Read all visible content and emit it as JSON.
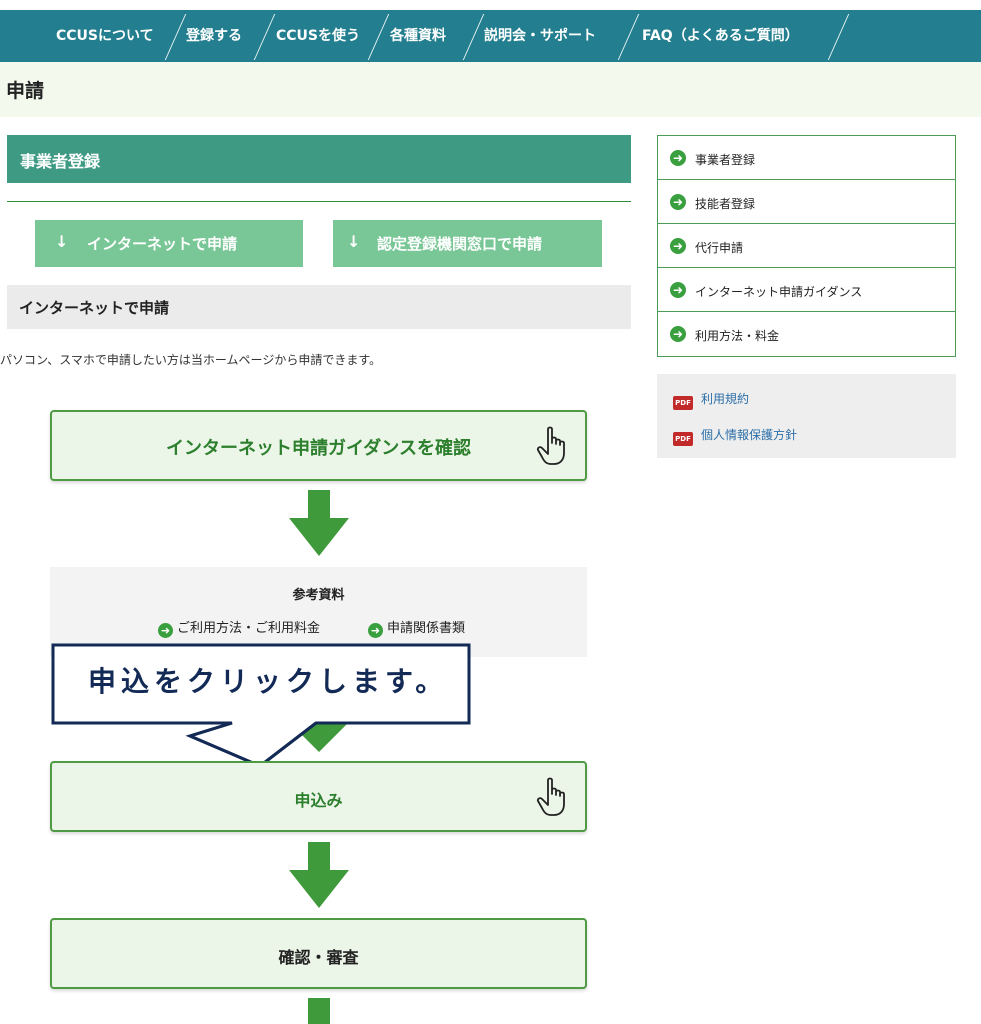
{
  "nav": {
    "items": [
      {
        "label": "CCUSについて"
      },
      {
        "label": "登録する"
      },
      {
        "label": "CCUSを使う"
      },
      {
        "label": "各種資料"
      },
      {
        "label": "説明会・サポート"
      },
      {
        "label": "FAQ（よくあるご質問）"
      }
    ]
  },
  "page": {
    "title": "申請"
  },
  "section": {
    "title": "事業者登録",
    "anchors": [
      {
        "arrow": "↓",
        "label": "インターネットで申請"
      },
      {
        "arrow": "↓",
        "label": "認定登録機関窓口で申請"
      }
    ],
    "sub_title": "インターネットで申請",
    "intro": "パソコン、スマホで申請したい方は当ホームページから申請できます。"
  },
  "flow": {
    "step1": "インターネット申請ガイダンスを確認",
    "reference": {
      "title": "参考資料",
      "links": [
        "ご利用方法・ご利用料金",
        "申請関係書類"
      ]
    },
    "step2": "申込み",
    "step3": "確認・審査"
  },
  "callout": {
    "text": "申込をクリックします。"
  },
  "sidebar": {
    "items": [
      {
        "label": "事業者登録"
      },
      {
        "label": "技能者登録"
      },
      {
        "label": "代行申請"
      },
      {
        "label": "インターネット申請ガイダンス"
      },
      {
        "label": "利用方法・料金"
      }
    ],
    "pdfs": [
      {
        "icon": "PDF",
        "label": "利用規約"
      },
      {
        "icon": "PDF",
        "label": "個人情報保護方針"
      }
    ]
  },
  "colors": {
    "nav": "#237f8f",
    "section_header": "#3f9a84",
    "anchor_button": "#79c796",
    "flow_border": "#4f9b44",
    "flow_arrow": "#3e9a3a",
    "callout_text": "#122a55"
  }
}
